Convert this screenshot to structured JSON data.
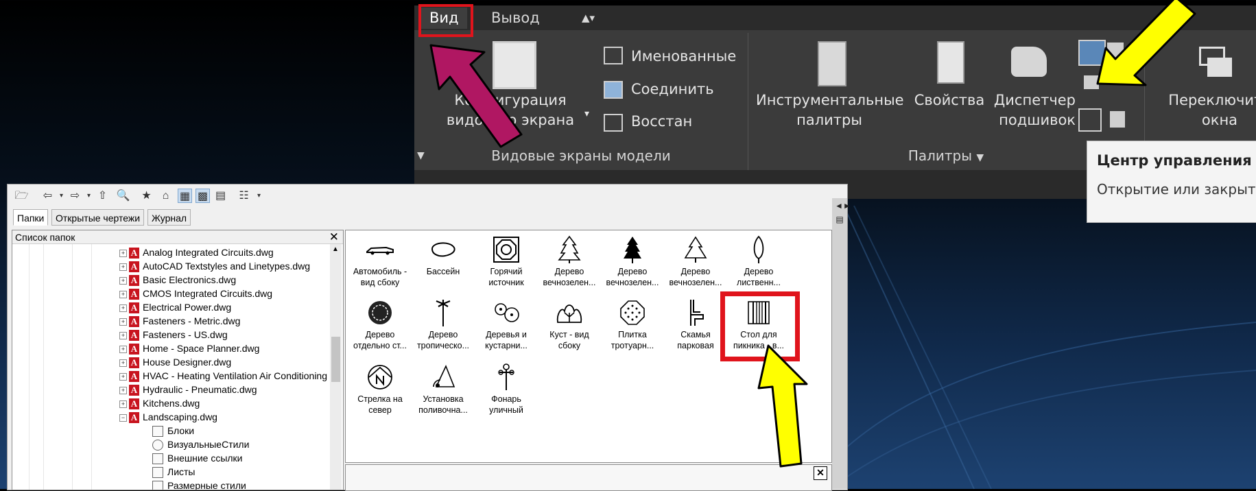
{
  "ribbon": {
    "tabs": [
      {
        "label": "Вид"
      },
      {
        "label": "Вывод"
      }
    ],
    "viewports_panel": {
      "title": "Видовые экраны модели",
      "config_label_line1": "Конфигурация",
      "config_label_line2": "видового экрана",
      "named": "Именованные",
      "join": "Соединить",
      "restore": "Восстан"
    },
    "palettes_panel": {
      "title": "Палитры",
      "tool_palettes_line1": "Инструментальные",
      "tool_palettes_line2": "палитры",
      "properties": "Свойства",
      "sheet_set_line1": "Диспетчер",
      "sheet_set_line2": "подшивок"
    },
    "switch_windows_line1": "Переключить",
    "switch_windows_line2": "окна"
  },
  "tooltip": {
    "title": "Центр управления",
    "description": "Открытие или закрытие"
  },
  "design_center": {
    "tabs": [
      "Папки",
      "Открытые чертежи",
      "Журнал"
    ],
    "tree_header": "Список папок",
    "tree_items": [
      "Analog Integrated Circuits.dwg",
      "AutoCAD Textstyles and Linetypes.dwg",
      "Basic Electronics.dwg",
      "CMOS Integrated Circuits.dwg",
      "Electrical Power.dwg",
      "Fasteners - Metric.dwg",
      "Fasteners - US.dwg",
      "Home - Space Planner.dwg",
      "House Designer.dwg",
      "HVAC - Heating Ventilation Air Conditioning",
      "Hydraulic - Pneumatic.dwg",
      "Kitchens.dwg",
      "Landscaping.dwg"
    ],
    "sub_items": [
      "Блоки",
      "ВизуальныеСтили",
      "Внешние ссылки",
      "Листы",
      "Размерные стили"
    ],
    "blocks": [
      {
        "line1": "Автомобиль -",
        "line2": "вид сбоку",
        "icon": "car-icon"
      },
      {
        "line1": "Бассейн",
        "line2": "",
        "icon": "pool-icon"
      },
      {
        "line1": "Горячий",
        "line2": "источник",
        "icon": "hot-spring-icon"
      },
      {
        "line1": "Дерево",
        "line2": "вечнозелен...",
        "icon": "evergreen-tree-icon"
      },
      {
        "line1": "Дерево",
        "line2": "вечнозелен...",
        "icon": "evergreen-tree-icon"
      },
      {
        "line1": "Дерево",
        "line2": "вечнозелен...",
        "icon": "evergreen-tree-icon"
      },
      {
        "line1": "Дерево",
        "line2": "лиственн...",
        "icon": "deciduous-tree-icon"
      },
      {
        "line1": "Дерево",
        "line2": "отдельно ст...",
        "icon": "tree-plan-icon"
      },
      {
        "line1": "Дерево",
        "line2": "тропическо...",
        "icon": "palm-tree-icon"
      },
      {
        "line1": "Деревья и",
        "line2": "кустарни...",
        "icon": "shrubs-icon"
      },
      {
        "line1": "Куст - вид",
        "line2": "сбоку",
        "icon": "bush-icon"
      },
      {
        "line1": "Плитка",
        "line2": "тротуарн...",
        "icon": "paving-icon"
      },
      {
        "line1": "Скамья",
        "line2": "парковая",
        "icon": "bench-icon"
      },
      {
        "line1": "Стол для",
        "line2": "пикника - в...",
        "icon": "picnic-table-icon"
      },
      {
        "line1": "Стрелка на",
        "line2": "север",
        "icon": "north-arrow-icon"
      },
      {
        "line1": "Установка",
        "line2": "поливочна...",
        "icon": "sprinkler-icon"
      },
      {
        "line1": "Фонарь",
        "line2": "уличный",
        "icon": "street-lamp-icon"
      }
    ]
  },
  "colors": {
    "highlight_red": "#e0141c",
    "arrow_yellow": "#ffff00",
    "arrow_magenta": "#b01762",
    "ribbon_bg": "#3b3b3b"
  }
}
